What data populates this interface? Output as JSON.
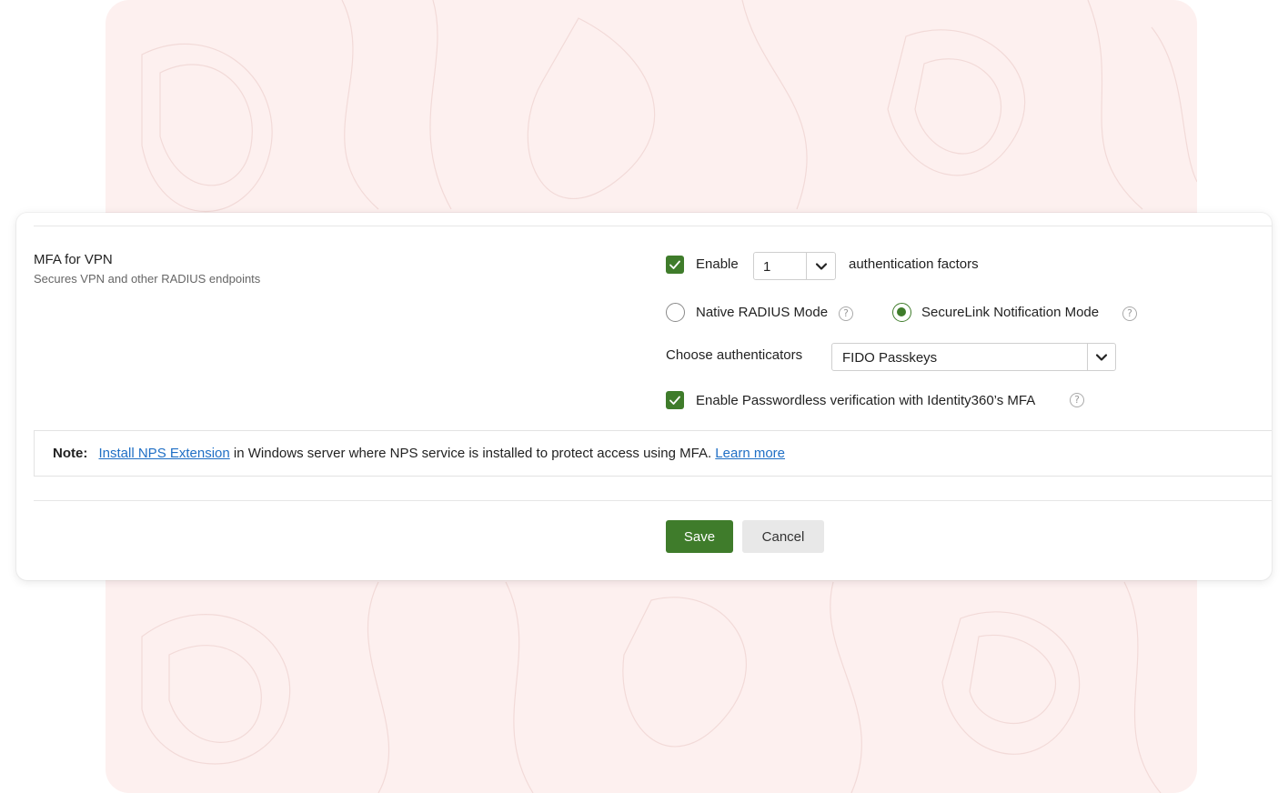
{
  "feature": {
    "title": "MFA for VPN",
    "description": "Secures VPN and other RADIUS endpoints"
  },
  "factors": {
    "enable_label": "Enable",
    "enabled": true,
    "count_value": "1",
    "suffix": "authentication factors"
  },
  "modes": {
    "native_label": "Native RADIUS Mode",
    "securelink_label": "SecureLink Notification Mode",
    "selected": "SecureLink Notification Mode",
    "help_glyph": "?"
  },
  "authenticators": {
    "label": "Choose authenticators",
    "value": "FIDO Passkeys"
  },
  "passwordless": {
    "label": "Enable Passwordless verification with Identity360’s MFA",
    "enabled": true
  },
  "note": {
    "prefix": "Note:",
    "link_text": "Install NPS Extension",
    "body": " in Windows server where NPS service is installed to protect access using MFA. ",
    "learn_more": "Learn more"
  },
  "actions": {
    "save_label": "Save",
    "cancel_label": "Cancel"
  },
  "colors": {
    "accent": "#3f7c2b",
    "link": "#1f6fc5",
    "background_panel": "#fdf0ef"
  }
}
